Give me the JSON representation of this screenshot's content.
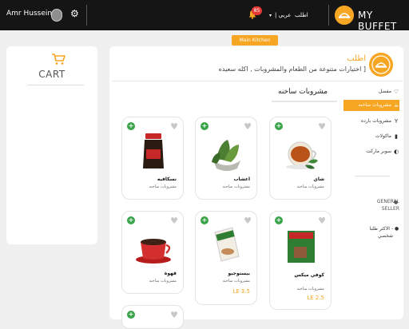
{
  "topbar": {
    "user_name": "Amr Hussein",
    "notification_count": "85",
    "language_label": "| عربي",
    "order_link": "اطلب",
    "brand": "MY BUFFET"
  },
  "kitchen_tag": "Main Kitchen",
  "cart": {
    "label": "CART"
  },
  "header": {
    "title": "اطلب",
    "subtitle": "اختيارات متنوعة من الطعام والمشروبات , اكله سعيده ]"
  },
  "category_title": "مشروبات ساخنه",
  "menu": [
    {
      "label": "مفضل",
      "icon": "heart-icon",
      "active": false
    },
    {
      "label": "مشروبات ساخنه",
      "icon": "cup-icon",
      "active": true
    },
    {
      "label": "مشروبات بارده",
      "icon": "glass-icon",
      "active": false
    },
    {
      "label": "ماكولات",
      "icon": "food-icon",
      "active": false
    },
    {
      "label": "سوبر ماركت",
      "icon": "cart-icon",
      "active": false
    }
  ],
  "filters": {
    "general_seller_line1": "GENERAL",
    "general_seller_line2": "SELLER",
    "sort_line1": "الاكثر طلبا -",
    "sort_line2": "شخصي"
  },
  "products": [
    {
      "name": "شاي",
      "category": "مشروبات ساخنه",
      "price": "",
      "image": "tea"
    },
    {
      "name": "اعشاب",
      "category": "مشروبات ساخنه",
      "price": "",
      "image": "herbs"
    },
    {
      "name": "نسكافيه",
      "category": "مشروبات ساخنه",
      "price": "",
      "image": "nescafe"
    },
    {
      "name": "كوفي ميكس",
      "category": "مشروبات ساخنه",
      "price": "LE 2.5",
      "image": "coffee-mix"
    },
    {
      "name": "بيستوجيو",
      "category": "مشروبات ساخنه",
      "price": "LE 3.5",
      "image": "cappuccino"
    },
    {
      "name": "قهوة",
      "category": "مشروبات ساخنه",
      "price": "",
      "image": "coffee"
    }
  ],
  "colors": {
    "accent": "#f6a623",
    "topbar": "#151515",
    "add": "#3aa44a",
    "badge": "#e53935"
  }
}
